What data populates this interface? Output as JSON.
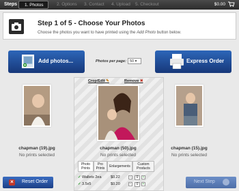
{
  "steps_bar": {
    "label": "Steps",
    "steps": [
      {
        "label": "1. Photos",
        "active": true
      },
      {
        "label": "2. Options",
        "active": false
      },
      {
        "label": "3. Contact",
        "active": false
      },
      {
        "label": "4. Upload",
        "active": false
      },
      {
        "label": "5. Checkout",
        "active": false
      }
    ],
    "cart_total": "$0.00"
  },
  "header": {
    "title": "Step 1 of 5 - Choose Your Photos",
    "subtitle_prefix": "Choose the photos you want to have printed using the ",
    "subtitle_emphasis": "Add Photo",
    "subtitle_suffix": " button below."
  },
  "toolbar": {
    "add_photos_label": "Add photos...",
    "photos_per_page_label": "Photos per page:",
    "photos_per_page_value": "50",
    "express_order_label": "Express Order"
  },
  "photos": [
    {
      "filename": "chapman (19).jpg",
      "status": "No prints selected"
    },
    {
      "filename": "chapman (50).jpg",
      "status": "No prints selected"
    },
    {
      "filename": "chapman (15).jpg",
      "status": "No prints selected"
    }
  ],
  "selected_photo": {
    "crop_edit_label": "Crop/Edit",
    "remove_label": "Remove",
    "tabs": [
      {
        "label": "Photo Prints"
      },
      {
        "label": "Pro Prints"
      },
      {
        "label": "Enlargements"
      },
      {
        "label": "Custom Products"
      }
    ],
    "rows": [
      {
        "name": "Wallets 2ea",
        "price": "$0.22",
        "qty": "0"
      },
      {
        "name": "3.5x5",
        "price": "$0.20",
        "qty": "0"
      }
    ]
  },
  "footer": {
    "reset_label": "Reset Order",
    "next_label": "Next Step"
  },
  "colors": {
    "button_blue": "#1f4f9e",
    "step_active": "#1a1a1a",
    "remove_red": "#c0392b",
    "check_green": "#2e9a2e"
  }
}
